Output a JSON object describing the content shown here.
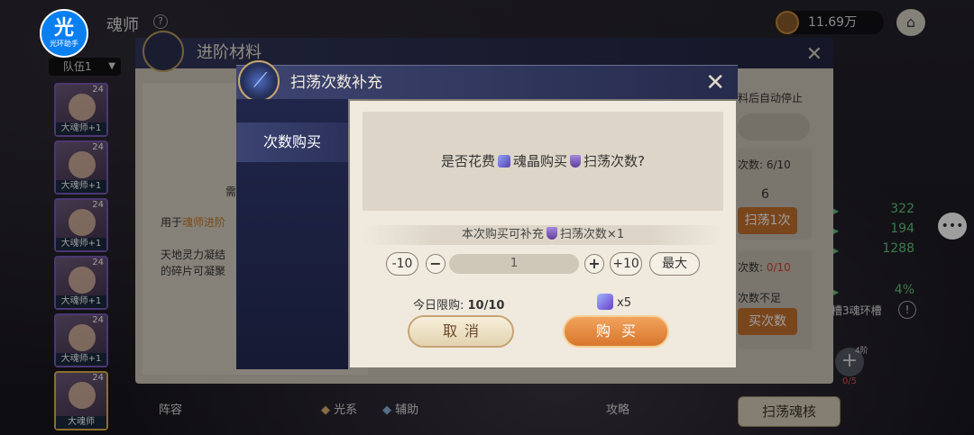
{
  "header": {
    "logo_big": "光",
    "logo_small": "光环助手",
    "title": "魂师",
    "help": "?",
    "team": "队伍1",
    "currency": "11.69万"
  },
  "heroes": [
    {
      "level": "24",
      "rank": "大魂师+1"
    },
    {
      "level": "24",
      "rank": "大魂师+1"
    },
    {
      "level": "24",
      "rank": "大魂师+1"
    },
    {
      "level": "24",
      "rank": "大魂师+1"
    },
    {
      "level": "24",
      "rank": "大魂师+1"
    },
    {
      "level": "24",
      "rank": "大魂师"
    }
  ],
  "advance_panel": {
    "title": "进阶材料",
    "need": "需",
    "use_prefix": "用于",
    "use_highlight": "魂师进阶",
    "desc_line1": "天地灵力凝结",
    "desc_line2": "的碎片可凝聚",
    "right_top": "料后自动停止",
    "count1_label": "次数: ",
    "count1_value": "6/10",
    "cost_value": "6",
    "sweep_btn": "扫荡1次",
    "count2_label": "次数: ",
    "count2_value": "0/10",
    "not_enough": "次数不足",
    "more_btn": "买次数"
  },
  "stats": [
    "322",
    "194",
    "1288",
    "4%"
  ],
  "slot_text": "槽3魂环槽",
  "plus": {
    "level": "4阶",
    "count": "0/5"
  },
  "bottom": {
    "lineup": "阵容",
    "light": "光系",
    "assist": "辅助",
    "guide": "攻略",
    "sweep_core": "扫荡魂核"
  },
  "modal": {
    "title": "扫荡次数补充",
    "side_tab": "次数购买",
    "msg_part1": "是否花费",
    "msg_part2": "魂晶购买",
    "msg_part3": "扫荡次数?",
    "sub_part1": "本次购买可补充",
    "sub_part2": "扫荡次数×1",
    "minus10": "-10",
    "minus": "−",
    "quantity": "1",
    "plus": "+",
    "plus10": "+10",
    "max": "最大",
    "limit_label": "今日限购: ",
    "limit_value": "10/10",
    "cost": "x5",
    "cancel": "取消",
    "buy": "购买"
  }
}
